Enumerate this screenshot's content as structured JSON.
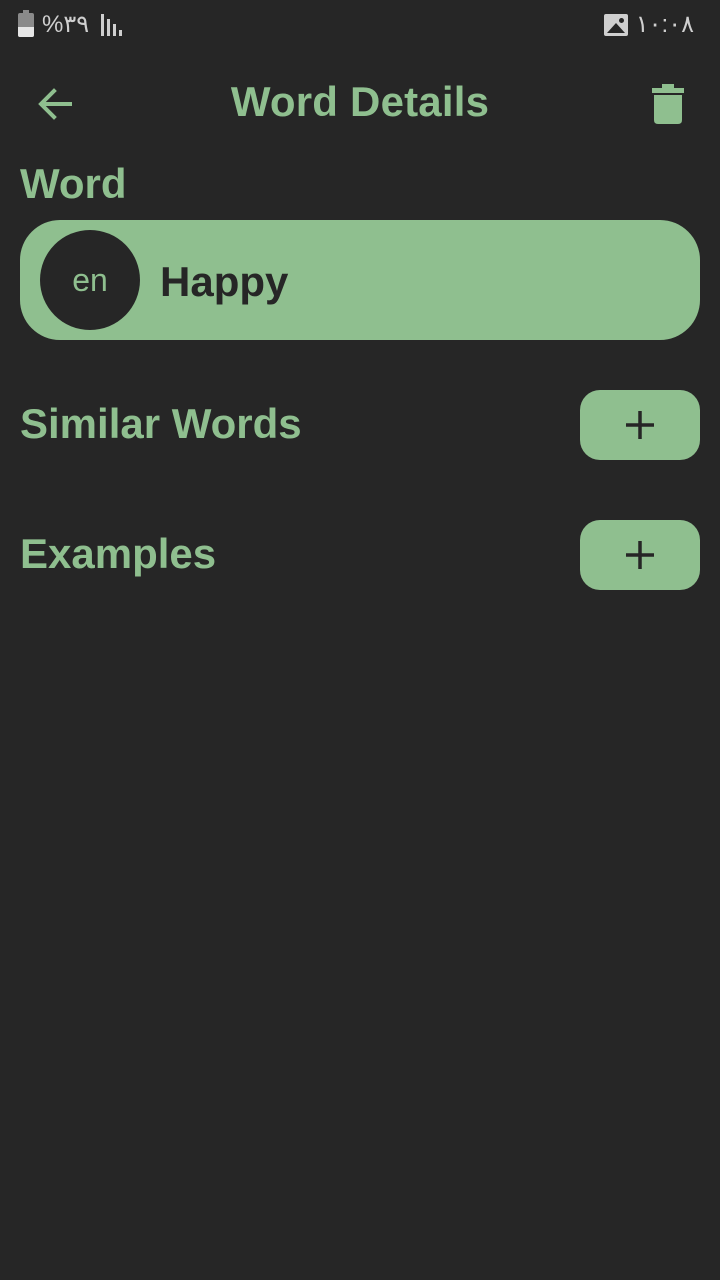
{
  "status_bar": {
    "battery": "%۳۹",
    "time": "۱۰:۰۸",
    "battery_level": 0.39,
    "icons": [
      "battery-icon",
      "signal-icon",
      "image-icon"
    ]
  },
  "app_bar": {
    "title": "Word Details",
    "icons": [
      "arrow-back-icon",
      "trash-icon"
    ]
  },
  "word_section": {
    "label": "Word",
    "language": "en",
    "word": "Happy"
  },
  "similar_words": {
    "label": "Similar Words",
    "add_icon": "plus-icon"
  },
  "examples": {
    "label": "Examples",
    "add_icon": "plus-icon"
  },
  "colors": {
    "background": "#262626",
    "accent": "#8fbf8f",
    "status_text": "#cfcfcf"
  }
}
